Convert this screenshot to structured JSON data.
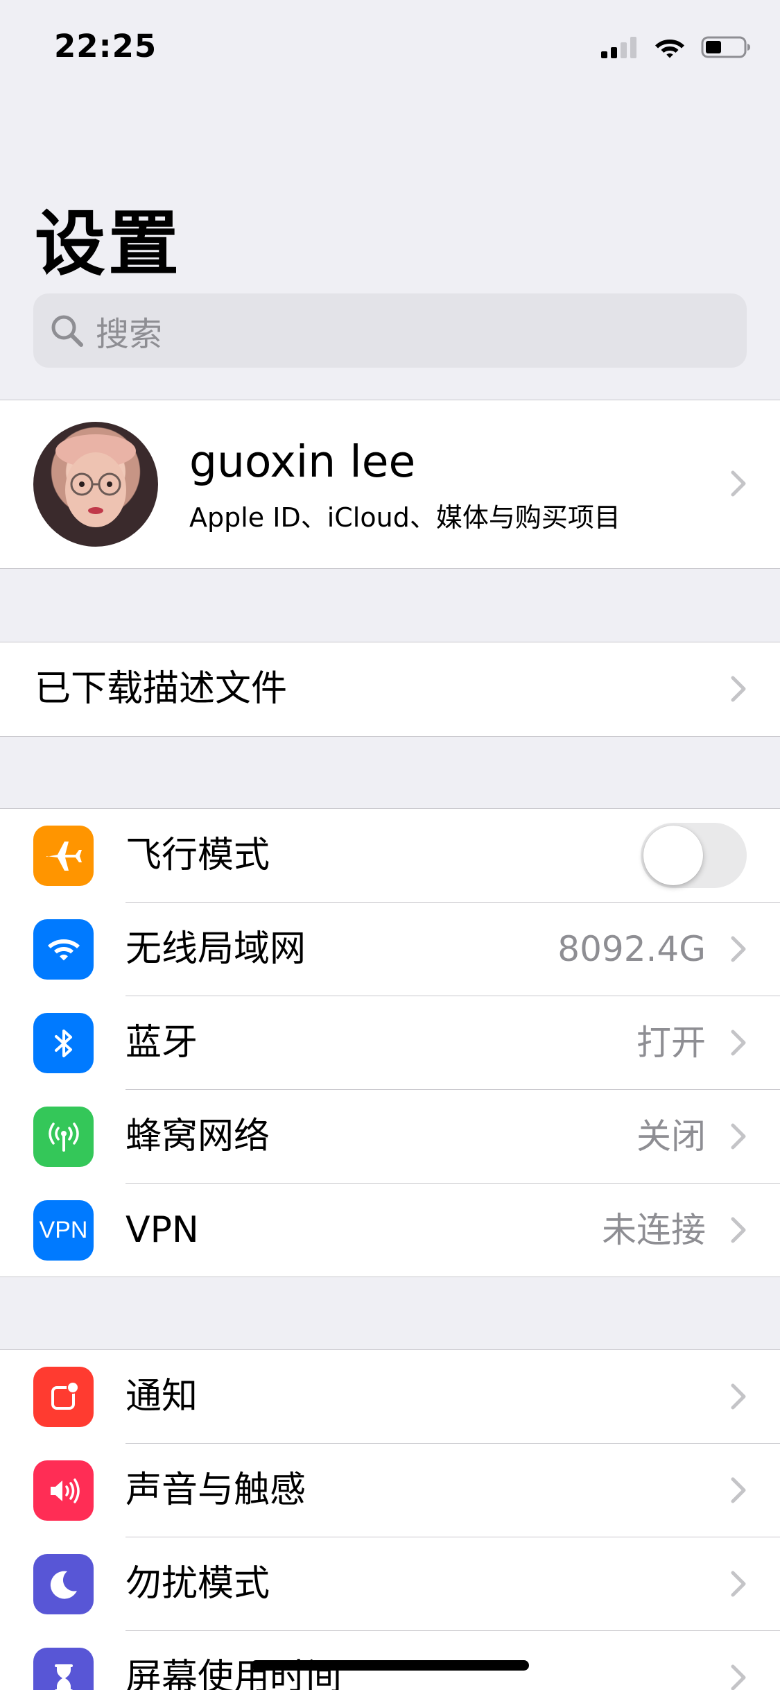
{
  "status_bar": {
    "time": "22:25",
    "signal_icon": "cellular-signal-icon",
    "wifi_icon": "wifi-icon",
    "battery_icon": "battery-icon"
  },
  "page": {
    "title": "设置"
  },
  "search": {
    "placeholder": "搜索",
    "icon": "search-icon"
  },
  "profile": {
    "name": "guoxin lee",
    "subtitle": "Apple ID、iCloud、媒体与购买项目"
  },
  "downloaded_profile": {
    "label": "已下载描述文件"
  },
  "connectivity": [
    {
      "label": "飞行模式",
      "icon": "airplane-icon",
      "color": "#ff9500",
      "toggle_on": false
    },
    {
      "label": "无线局域网",
      "icon": "wifi-icon",
      "color": "#007aff",
      "value": "8092.4G"
    },
    {
      "label": "蓝牙",
      "icon": "bluetooth-icon",
      "color": "#007aff",
      "value": "打开"
    },
    {
      "label": "蜂窝网络",
      "icon": "cellular-antenna-icon",
      "color": "#34c759",
      "value": "关闭"
    },
    {
      "label": "VPN",
      "icon": "vpn-icon",
      "color": "#007aff",
      "value": "未连接",
      "icon_text": "VPN"
    }
  ],
  "general": [
    {
      "label": "通知",
      "icon": "notifications-icon",
      "color": "#ff3b30"
    },
    {
      "label": "声音与触感",
      "icon": "sound-icon",
      "color": "#ff2d55"
    },
    {
      "label": "勿扰模式",
      "icon": "moon-icon",
      "color": "#5856d6"
    },
    {
      "label": "屏幕使用时间",
      "icon": "hourglass-icon",
      "color": "#5856d6"
    }
  ]
}
